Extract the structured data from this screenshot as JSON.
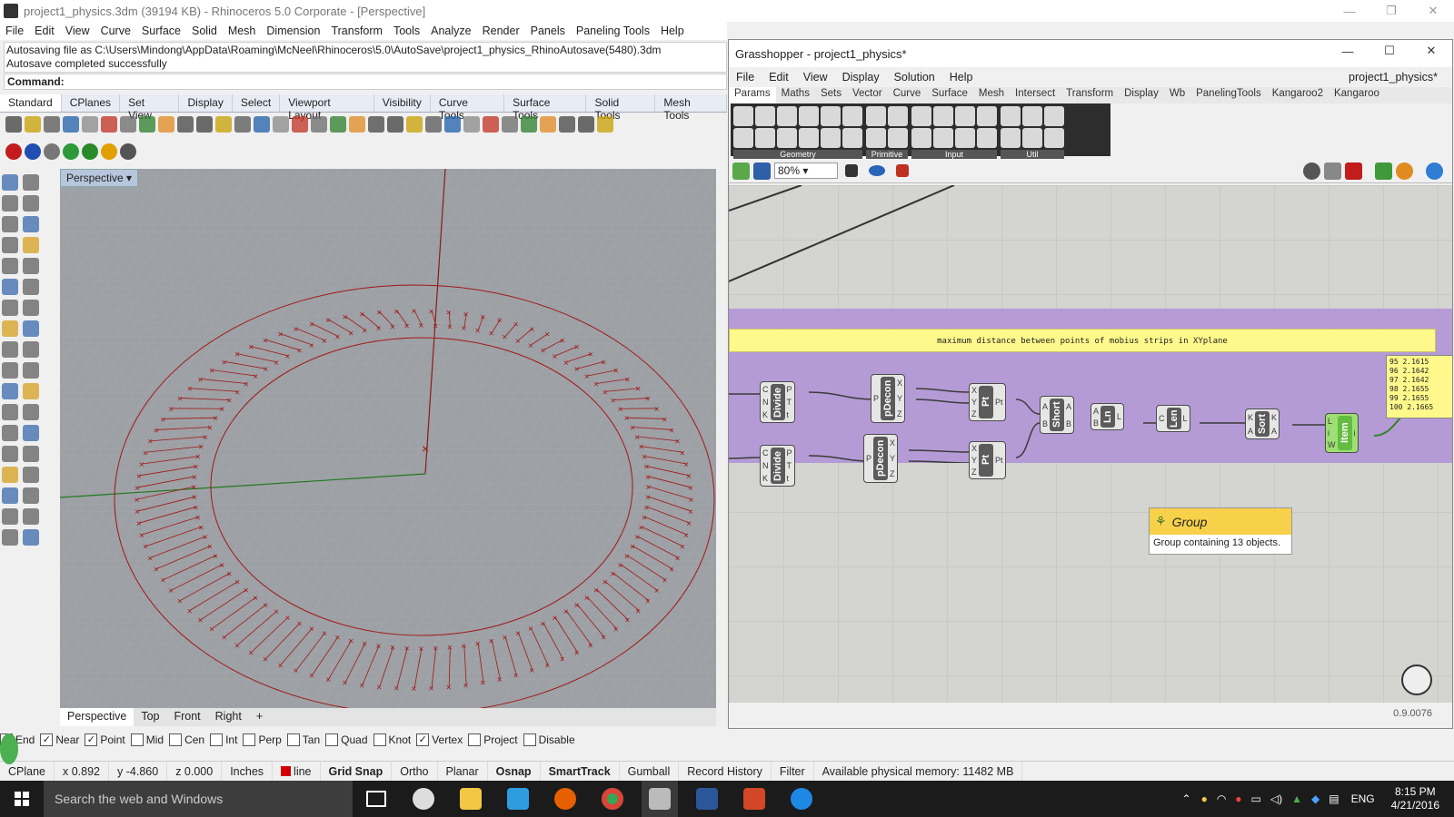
{
  "rhino": {
    "title": "project1_physics.3dm (39194 KB) - Rhinoceros  5.0 Corporate - [Perspective]",
    "menu": [
      "File",
      "Edit",
      "View",
      "Curve",
      "Surface",
      "Solid",
      "Mesh",
      "Dimension",
      "Transform",
      "Tools",
      "Analyze",
      "Render",
      "Panels",
      "Paneling Tools",
      "Help"
    ],
    "history_line1": "Autosaving file as C:\\Users\\Mindong\\AppData\\Roaming\\McNeel\\Rhinoceros\\5.0\\AutoSave\\project1_physics_RhinoAutosave(5480).3dm",
    "history_line2": "Autosave completed successfully",
    "command_label": "Command:",
    "toolbar_tabs": [
      "Standard",
      "CPlanes",
      "Set View",
      "Display",
      "Select",
      "Viewport Layout",
      "Visibility",
      "Curve Tools",
      "Surface Tools",
      "Solid Tools",
      "Mesh Tools"
    ],
    "viewport_label": "Perspective",
    "viewport_tabs": [
      "Perspective",
      "Top",
      "Front",
      "Right"
    ],
    "osnaps": [
      {
        "label": "End",
        "checked": true
      },
      {
        "label": "Near",
        "checked": true
      },
      {
        "label": "Point",
        "checked": true
      },
      {
        "label": "Mid",
        "checked": false
      },
      {
        "label": "Cen",
        "checked": false
      },
      {
        "label": "Int",
        "checked": false
      },
      {
        "label": "Perp",
        "checked": false
      },
      {
        "label": "Tan",
        "checked": false
      },
      {
        "label": "Quad",
        "checked": false
      },
      {
        "label": "Knot",
        "checked": false
      },
      {
        "label": "Vertex",
        "checked": true
      },
      {
        "label": "Project",
        "checked": false
      },
      {
        "label": "Disable",
        "checked": false
      }
    ],
    "status": {
      "cplane": "CPlane",
      "x": "x 0.892",
      "y": "y -4.860",
      "z": "z 0.000",
      "units": "Inches",
      "layer": "line",
      "toggles": [
        "Grid Snap",
        "Ortho",
        "Planar",
        "Osnap",
        "SmartTrack",
        "Gumball",
        "Record History",
        "Filter"
      ],
      "memory": "Available physical memory: 11482 MB"
    },
    "colors": {
      "viewport_bg": "#9da0a4",
      "curve": "#a01818",
      "x_axis": "#8b1b1b",
      "y_axis": "#1f7a1f"
    }
  },
  "grasshopper": {
    "title": "Grasshopper - project1_physics*",
    "menu": [
      "File",
      "Edit",
      "View",
      "Display",
      "Solution",
      "Help"
    ],
    "doc_name": "project1_physics*",
    "tabs": [
      "Params",
      "Maths",
      "Sets",
      "Vector",
      "Curve",
      "Surface",
      "Mesh",
      "Intersect",
      "Transform",
      "Display",
      "Wb",
      "PanelingTools",
      "Kangaroo2",
      "Kangaroo"
    ],
    "ribbon_groups": [
      "Geometry",
      "Primitive",
      "Input",
      "Util"
    ],
    "zoom": "80%",
    "note": "maximum distance between points of mobius strips in XYplane",
    "components": [
      {
        "name": "Divide",
        "in": [
          "C",
          "N",
          "K"
        ],
        "out": [
          "P",
          "T",
          "t"
        ]
      },
      {
        "name": "Divide",
        "in": [
          "C",
          "N",
          "K"
        ],
        "out": [
          "P",
          "T",
          "t"
        ]
      },
      {
        "name": "pDecon",
        "in": [
          "P"
        ],
        "out": [
          "X",
          "Y",
          "Z"
        ]
      },
      {
        "name": "pDecon",
        "in": [
          "P"
        ],
        "out": [
          "X",
          "Y",
          "Z"
        ]
      },
      {
        "name": "Pt",
        "in": [
          "X",
          "Y",
          "Z"
        ],
        "out": [
          "Pt"
        ]
      },
      {
        "name": "Pt",
        "in": [
          "X",
          "Y",
          "Z"
        ],
        "out": [
          "Pt"
        ]
      },
      {
        "name": "Short",
        "in": [
          "A",
          "B"
        ],
        "out": [
          "A",
          "B"
        ]
      },
      {
        "name": "Ln",
        "in": [
          "A",
          "B"
        ],
        "out": [
          "L"
        ]
      },
      {
        "name": "Len",
        "in": [
          "C"
        ],
        "out": [
          "L"
        ]
      },
      {
        "name": "Sort",
        "in": [
          "K",
          "A"
        ],
        "out": [
          "K",
          "A"
        ]
      },
      {
        "name": "Item",
        "in": [
          "L",
          "i",
          "W"
        ],
        "out": [
          "i"
        ]
      }
    ],
    "panel_values": [
      "95 2.1615",
      "96 2.1642",
      "97 2.1642",
      "98 2.1655",
      "99 2.1655",
      "100 2.1665"
    ],
    "tooltip": {
      "title": "Group",
      "body": "Group containing 13 objects."
    },
    "version": "0.9.0076",
    "colors": {
      "group": "#b498d6",
      "note": "#fff98c",
      "canvas": "#d4d4d0"
    }
  },
  "taskbar": {
    "search_placeholder": "Search the web and Windows",
    "lang": "ENG",
    "time": "8:15 PM",
    "date": "4/21/2016"
  }
}
